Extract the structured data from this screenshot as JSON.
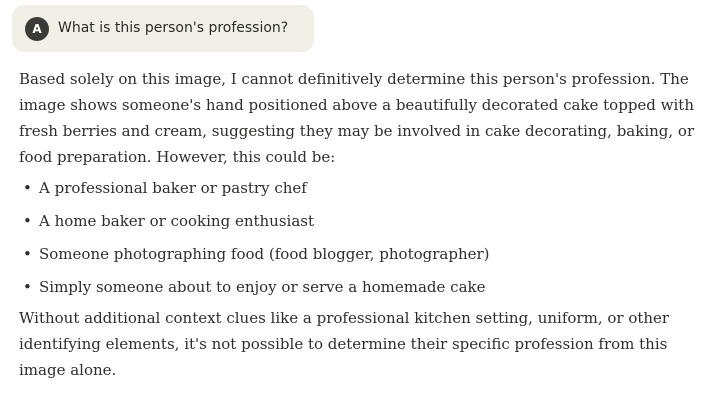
{
  "user_message": {
    "avatar_initial": "A",
    "text": "What is this person's profession?"
  },
  "response": {
    "intro": "Based solely on this image, I cannot definitively determine this person's profession. The image shows someone's hand positioned above a beautifully decorated cake topped with fresh berries and cream, suggesting they may be involved in cake decorating, baking, or food preparation. However, this could be:",
    "bullets": [
      "A professional baker or pastry chef",
      "A home baker or cooking enthusiast",
      "Someone photographing food (food blogger, photographer)",
      "Simply someone about to enjoy or serve a homemade cake"
    ],
    "bullet_glyph": "•",
    "outro": "Without additional context clues like a professional kitchen setting, uniform, or other identifying elements, it's not possible to determine their specific profession from this image alone."
  }
}
